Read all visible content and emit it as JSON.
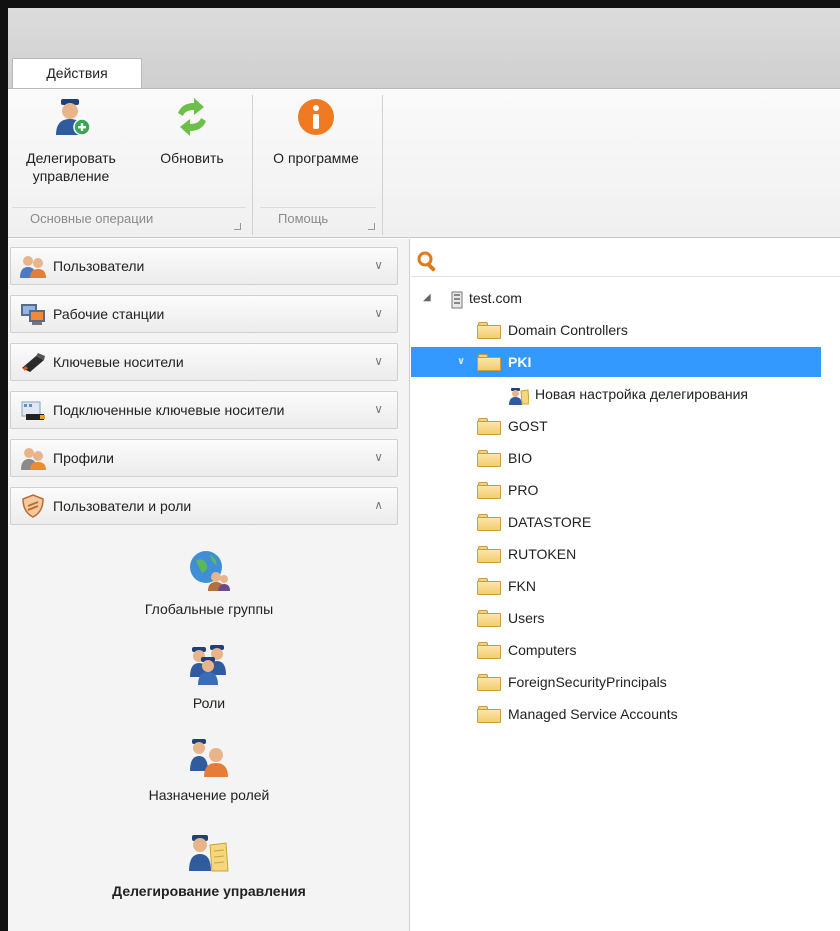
{
  "ribbon": {
    "tab_actions": "Действия",
    "buttons": {
      "delegate_line1": "Делегировать",
      "delegate_line2": "управление",
      "refresh": "Обновить",
      "about": "О программе"
    },
    "groups": {
      "basic": "Основные операции",
      "help": "Помощь"
    }
  },
  "sidebar": {
    "sections": [
      {
        "label": "Пользователи",
        "icon": "users-icon",
        "expanded": false
      },
      {
        "label": "Рабочие станции",
        "icon": "workstations-icon",
        "expanded": false
      },
      {
        "label": "Ключевые носители",
        "icon": "usb-key-icon",
        "expanded": false
      },
      {
        "label": "Подключенные ключевые носители",
        "icon": "connected-keys-icon",
        "expanded": false
      },
      {
        "label": "Профили",
        "icon": "profiles-icon",
        "expanded": false
      },
      {
        "label": "Пользователи и роли",
        "icon": "shield-icon",
        "expanded": true
      }
    ],
    "nav_items": [
      {
        "label": "Глобальные группы",
        "icon": "global-groups-icon"
      },
      {
        "label": "Роли",
        "icon": "roles-icon"
      },
      {
        "label": "Назначение ролей",
        "icon": "role-assignment-icon"
      },
      {
        "label": "Делегирование управления",
        "icon": "delegation-icon",
        "active": true
      }
    ]
  },
  "tree": {
    "root": "test.com",
    "nodes": [
      {
        "label": "Domain Controllers"
      },
      {
        "label": "PKI",
        "selected": true,
        "expanded": true
      },
      {
        "label": "Новая настройка делегирования",
        "type": "delegation"
      },
      {
        "label": "GOST"
      },
      {
        "label": "BIO"
      },
      {
        "label": "PRO"
      },
      {
        "label": "DATASTORE"
      },
      {
        "label": "RUTOKEN"
      },
      {
        "label": "FKN"
      },
      {
        "label": "Users"
      },
      {
        "label": "Computers"
      },
      {
        "label": "ForeignSecurityPrincipals"
      },
      {
        "label": "Managed Service Accounts"
      }
    ]
  },
  "colors": {
    "selection": "#3399ff",
    "about_orange": "#f07a22",
    "refresh_green": "#6cc04a"
  }
}
